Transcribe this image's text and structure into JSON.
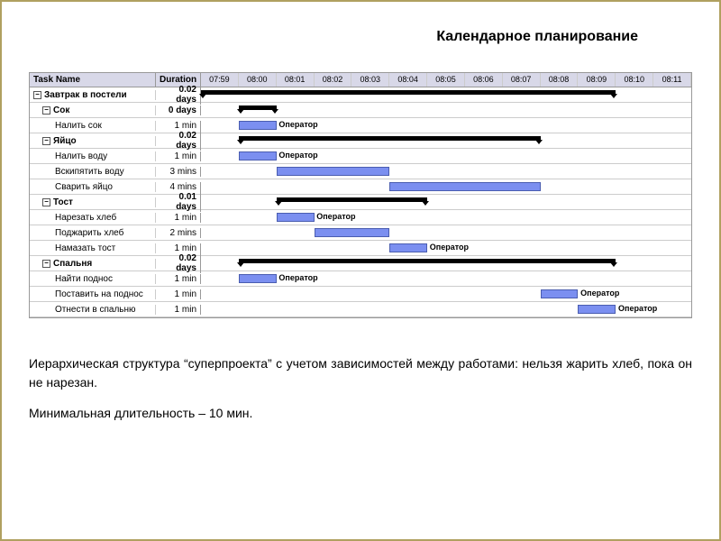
{
  "title": "Календарное планирование",
  "headers": {
    "task": "Task Name",
    "duration": "Duration"
  },
  "timeline": [
    "07:59",
    "08:00",
    "08:01",
    "08:02",
    "08:03",
    "08:04",
    "08:05",
    "08:06",
    "08:07",
    "08:08",
    "08:09",
    "08:10",
    "08:11"
  ],
  "resource_label": "Оператор",
  "rows": [
    {
      "name": "Завтрак в постели",
      "duration": "0.02 days",
      "level": 0,
      "bold": true,
      "toggle": true,
      "type": "summary",
      "start": 0,
      "end": 11
    },
    {
      "name": "Сок",
      "duration": "0 days",
      "level": 1,
      "bold": true,
      "toggle": true,
      "type": "summary",
      "start": 1,
      "end": 2
    },
    {
      "name": "Налить сок",
      "duration": "1 min",
      "level": 2,
      "bold": false,
      "type": "task",
      "start": 1,
      "end": 2,
      "label": true
    },
    {
      "name": "Яйцо",
      "duration": "0.02 days",
      "level": 1,
      "bold": true,
      "toggle": true,
      "type": "summary",
      "start": 1,
      "end": 9
    },
    {
      "name": "Налить воду",
      "duration": "1 min",
      "level": 2,
      "bold": false,
      "type": "task",
      "start": 1,
      "end": 2,
      "label": true
    },
    {
      "name": "Вскипятить воду",
      "duration": "3 mins",
      "level": 2,
      "bold": false,
      "type": "task",
      "start": 2,
      "end": 5
    },
    {
      "name": "Сварить яйцо",
      "duration": "4 mins",
      "level": 2,
      "bold": false,
      "type": "task",
      "start": 5,
      "end": 9
    },
    {
      "name": "Тост",
      "duration": "0.01 days",
      "level": 1,
      "bold": true,
      "toggle": true,
      "type": "summary",
      "start": 2,
      "end": 6
    },
    {
      "name": "Нарезать хлеб",
      "duration": "1 min",
      "level": 2,
      "bold": false,
      "type": "task",
      "start": 2,
      "end": 3,
      "label": true
    },
    {
      "name": "Поджарить хлеб",
      "duration": "2 mins",
      "level": 2,
      "bold": false,
      "type": "task",
      "start": 3,
      "end": 5
    },
    {
      "name": "Намазать тост",
      "duration": "1 min",
      "level": 2,
      "bold": false,
      "type": "task",
      "start": 5,
      "end": 6,
      "label": true
    },
    {
      "name": "Спальня",
      "duration": "0.02 days",
      "level": 1,
      "bold": true,
      "toggle": true,
      "type": "summary",
      "start": 1,
      "end": 11
    },
    {
      "name": "Найти поднос",
      "duration": "1 min",
      "level": 2,
      "bold": false,
      "type": "task",
      "start": 1,
      "end": 2,
      "label": true
    },
    {
      "name": "Поставить на поднос",
      "duration": "1 min",
      "level": 2,
      "bold": false,
      "type": "task",
      "start": 9,
      "end": 10,
      "label": true
    },
    {
      "name": "Отнести в спальню",
      "duration": "1 min",
      "level": 2,
      "bold": false,
      "type": "task",
      "start": 10,
      "end": 11,
      "label": true
    }
  ],
  "caption": "Иерархическая структура “суперпроекта” с учетом зависимостей между работами: нельзя жарить хлеб, пока он не нарезан.",
  "caption2": "Минимальная длительность – 10 мин.",
  "chart_data": {
    "type": "gantt",
    "title": "Календарное планирование",
    "time_unit": "minutes from 07:59",
    "timeline_ticks": [
      "07:59",
      "08:00",
      "08:01",
      "08:02",
      "08:03",
      "08:04",
      "08:05",
      "08:06",
      "08:07",
      "08:08",
      "08:09",
      "08:10",
      "08:11"
    ],
    "tasks": [
      {
        "name": "Завтрак в постели",
        "duration_label": "0.02 days",
        "start": "07:59",
        "end": "08:10",
        "summary": true,
        "parent": null
      },
      {
        "name": "Сок",
        "duration_label": "0 days",
        "start": "08:00",
        "end": "08:01",
        "summary": true,
        "parent": "Завтрак в постели"
      },
      {
        "name": "Налить сок",
        "duration_label": "1 min",
        "start": "08:00",
        "end": "08:01",
        "resource": "Оператор",
        "parent": "Сок"
      },
      {
        "name": "Яйцо",
        "duration_label": "0.02 days",
        "start": "08:00",
        "end": "08:08",
        "summary": true,
        "parent": "Завтрак в постели"
      },
      {
        "name": "Налить воду",
        "duration_label": "1 min",
        "start": "08:00",
        "end": "08:01",
        "resource": "Оператор",
        "parent": "Яйцо"
      },
      {
        "name": "Вскипятить воду",
        "duration_label": "3 mins",
        "start": "08:01",
        "end": "08:04",
        "parent": "Яйцо"
      },
      {
        "name": "Сварить яйцо",
        "duration_label": "4 mins",
        "start": "08:04",
        "end": "08:08",
        "parent": "Яйцо"
      },
      {
        "name": "Тост",
        "duration_label": "0.01 days",
        "start": "08:01",
        "end": "08:05",
        "summary": true,
        "parent": "Завтрак в постели"
      },
      {
        "name": "Нарезать хлеб",
        "duration_label": "1 min",
        "start": "08:01",
        "end": "08:02",
        "resource": "Оператор",
        "parent": "Тост"
      },
      {
        "name": "Поджарить хлеб",
        "duration_label": "2 mins",
        "start": "08:02",
        "end": "08:04",
        "parent": "Тост"
      },
      {
        "name": "Намазать тост",
        "duration_label": "1 min",
        "start": "08:04",
        "end": "08:05",
        "resource": "Оператор",
        "parent": "Тост"
      },
      {
        "name": "Спальня",
        "duration_label": "0.02 days",
        "start": "08:00",
        "end": "08:10",
        "summary": true,
        "parent": "Завтрак в постели"
      },
      {
        "name": "Найти поднос",
        "duration_label": "1 min",
        "start": "08:00",
        "end": "08:01",
        "resource": "Оператор",
        "parent": "Спальня"
      },
      {
        "name": "Поставить на поднос",
        "duration_label": "1 min",
        "start": "08:08",
        "end": "08:09",
        "resource": "Оператор",
        "parent": "Спальня"
      },
      {
        "name": "Отнести в спальню",
        "duration_label": "1 min",
        "start": "08:09",
        "end": "08:10",
        "resource": "Оператор",
        "parent": "Спальня"
      }
    ]
  }
}
